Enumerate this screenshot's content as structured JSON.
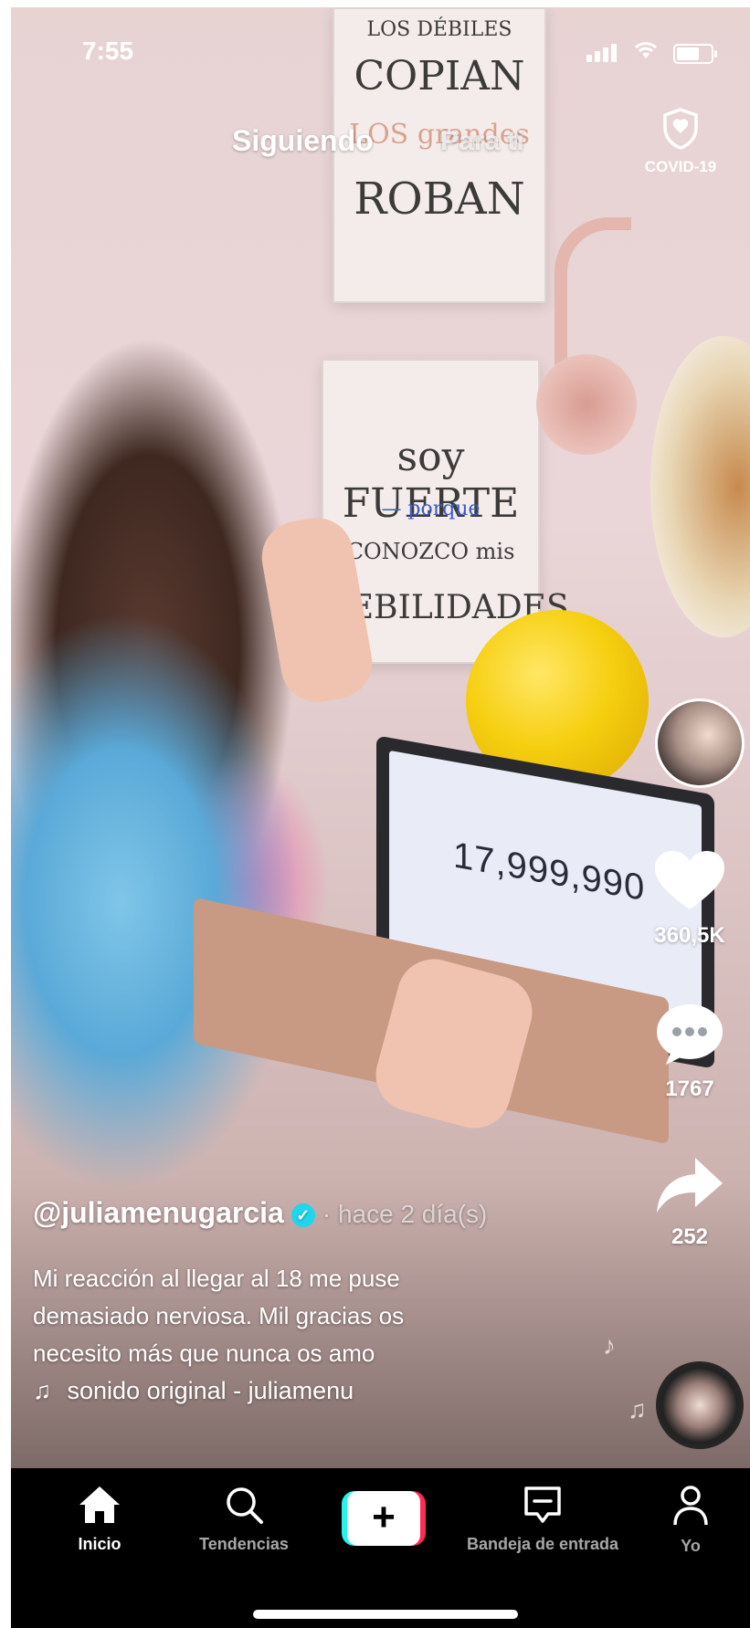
{
  "status_bar": {
    "time": "7:55"
  },
  "feed_tabs": {
    "following": "Siguiendo",
    "for_you": "Para ti"
  },
  "covid": {
    "label": "COVID-19"
  },
  "video_scene": {
    "poster_top_lines": [
      "LOS DÉBILES",
      "COPIAN",
      "LOS grandes",
      "ROBAN"
    ],
    "poster_mid_lines": [
      "soy FUERTE",
      "— porque",
      "CONOZCO mis",
      "DEBILIDADES"
    ],
    "laptop_counter": "17,999,990"
  },
  "actions": {
    "likes": "360,5K",
    "comments": "1767",
    "shares": "252"
  },
  "post": {
    "username": "@juliamenugarcia",
    "time_ago": "· hace 2 día(s)",
    "description_lines": [
      "Mi reacción al llegar al 18 me puse",
      "demasiado nerviosa. Mil gracias os",
      "necesito más que nunca os amo"
    ],
    "sound": "sonido original - juliamenu"
  },
  "bottom_nav": {
    "home": "Inicio",
    "discover": "Tendencias",
    "inbox": "Bandeja de entrada",
    "profile": "Yo"
  },
  "colors": {
    "accent_cyan": "#25f4ee",
    "accent_red": "#fe2c55",
    "verified": "#20d5ec"
  },
  "icons": [
    "home-icon",
    "search-icon",
    "plus-icon",
    "inbox-icon",
    "profile-icon",
    "heart-icon",
    "comment-icon",
    "share-icon",
    "shield-icon",
    "music-note-icon"
  ]
}
